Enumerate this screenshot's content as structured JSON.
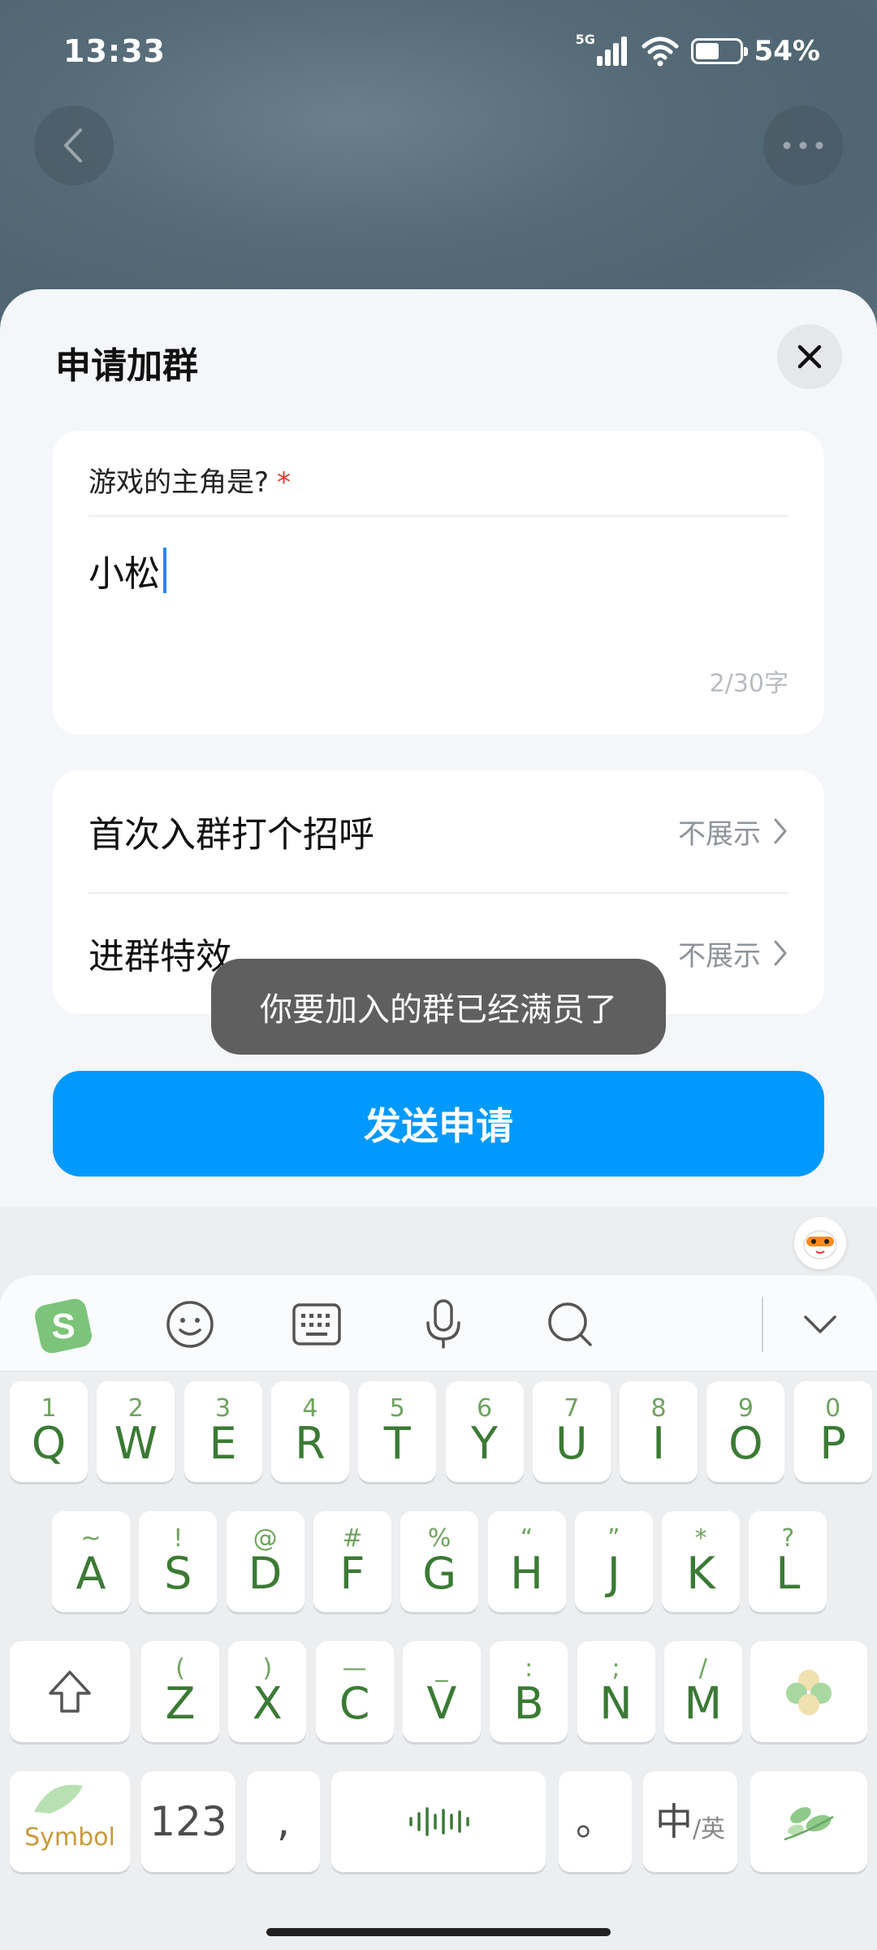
{
  "status_bar": {
    "time": "13:33",
    "network": "5G",
    "battery": "54%",
    "battery_level": 0.54
  },
  "sheet": {
    "title": "申请加群",
    "question": {
      "label": "游戏的主角是?",
      "required_mark": "*",
      "answer": "小松",
      "counter": "2/30字"
    },
    "options": [
      {
        "label": "首次入群打个招呼",
        "value": "不展示"
      },
      {
        "label": "进群特效",
        "value": "不展示"
      }
    ],
    "send_label": "发送申请"
  },
  "toast": {
    "message": "你要加入的群已经满员了"
  },
  "keyboard": {
    "toolbar": [
      "sogou-logo-icon",
      "emoji-icon",
      "keyboard-icon",
      "mic-icon",
      "search-icon",
      "collapse-icon"
    ],
    "row1": [
      {
        "sub": "1",
        "main": "Q"
      },
      {
        "sub": "2",
        "main": "W"
      },
      {
        "sub": "3",
        "main": "E"
      },
      {
        "sub": "4",
        "main": "R"
      },
      {
        "sub": "5",
        "main": "T"
      },
      {
        "sub": "6",
        "main": "Y"
      },
      {
        "sub": "7",
        "main": "U"
      },
      {
        "sub": "8",
        "main": "I"
      },
      {
        "sub": "9",
        "main": "O"
      },
      {
        "sub": "0",
        "main": "P"
      }
    ],
    "row2": [
      {
        "sub": "~",
        "main": "A"
      },
      {
        "sub": "!",
        "main": "S"
      },
      {
        "sub": "@",
        "main": "D"
      },
      {
        "sub": "#",
        "main": "F"
      },
      {
        "sub": "%",
        "main": "G"
      },
      {
        "sub": "“",
        "main": "H"
      },
      {
        "sub": "”",
        "main": "J"
      },
      {
        "sub": "*",
        "main": "K"
      },
      {
        "sub": "?",
        "main": "L"
      }
    ],
    "row3": [
      {
        "sub": "(",
        "main": "Z"
      },
      {
        "sub": ")",
        "main": "X"
      },
      {
        "sub": "—",
        "main": "C"
      },
      {
        "sub": "_",
        "main": "V"
      },
      {
        "sub": ":",
        "main": "B"
      },
      {
        "sub": ";",
        "main": "N"
      },
      {
        "sub": "/",
        "main": "M"
      }
    ],
    "symbol_label": "Symbol",
    "num_label": "123",
    "comma_label": ",",
    "period_label": "。",
    "lang_main": "中",
    "lang_sub": "/英"
  }
}
